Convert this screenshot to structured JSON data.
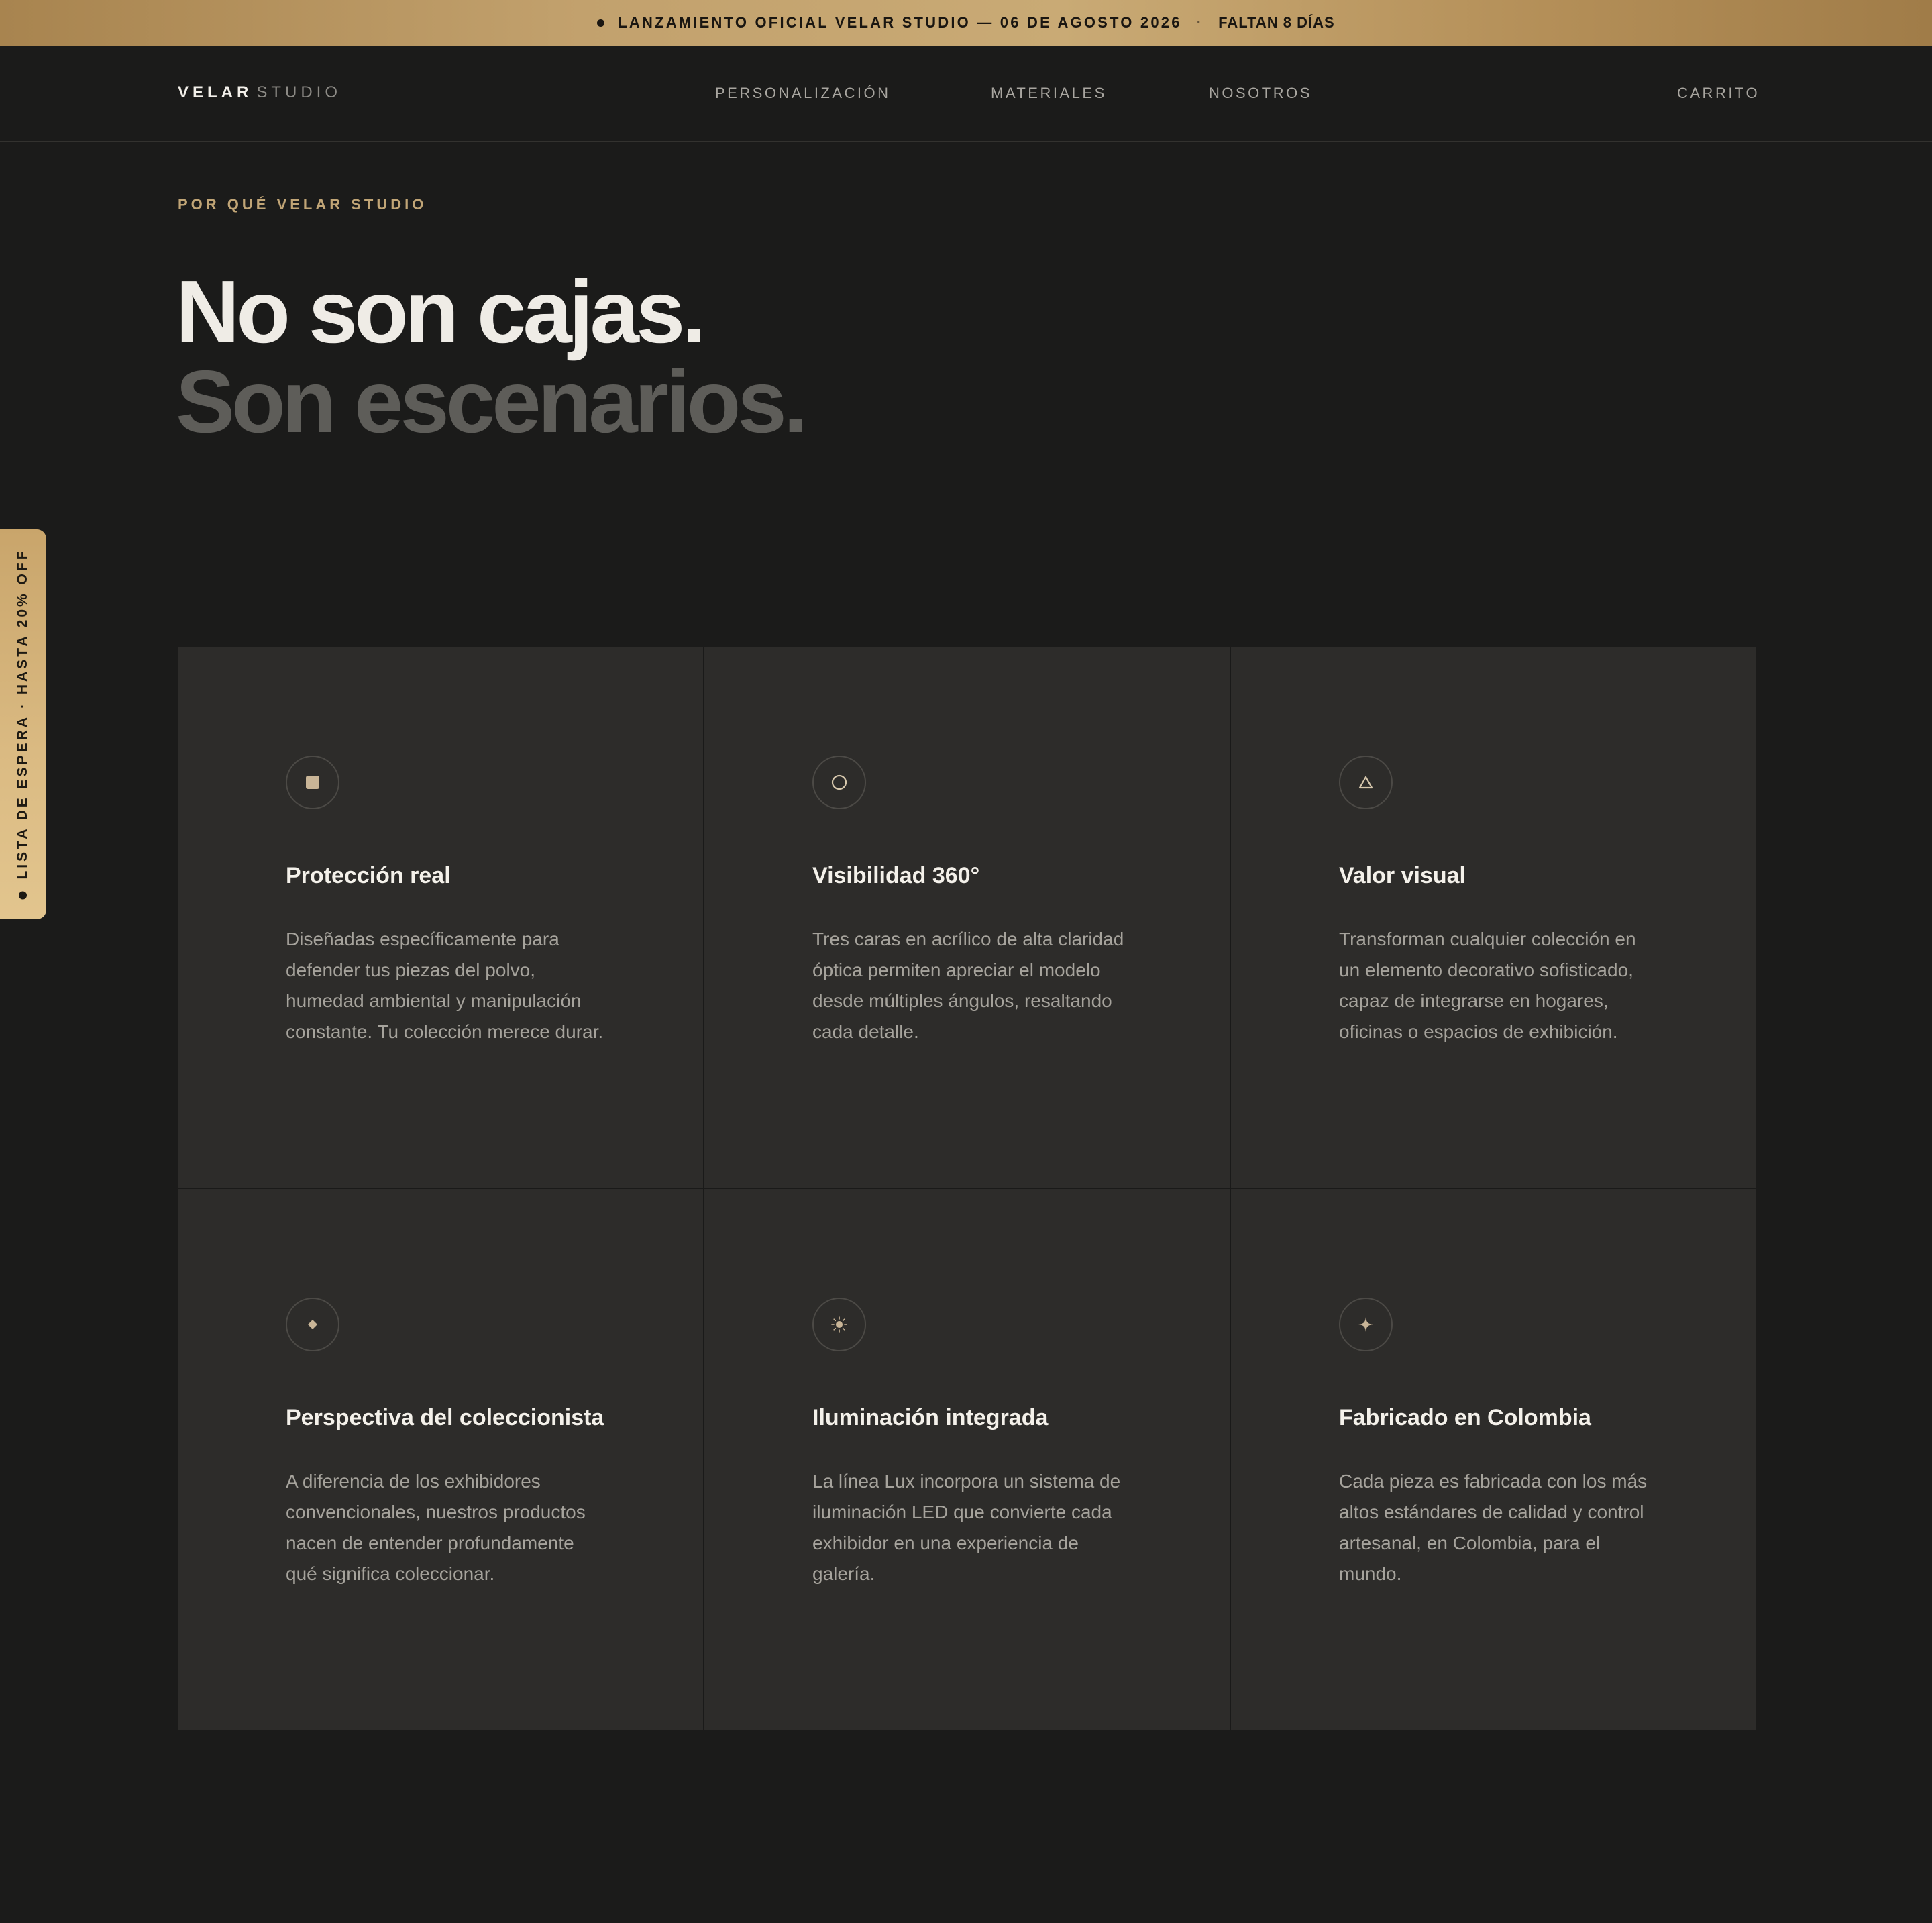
{
  "banner": {
    "text": "LANZAMIENTO OFICIAL VELAR STUDIO — 06 DE AGOSTO 2026",
    "separator": "·",
    "countdown": "FALTAN 8 DÍAS"
  },
  "nav": {
    "logo_bold": "VELAR",
    "logo_light": "STUDIO",
    "links": [
      "PERSONALIZACIÓN",
      "MATERIALES",
      "NOSOTROS"
    ],
    "cart": "CARRITO"
  },
  "hero": {
    "eyebrow": "POR QUÉ VELAR STUDIO",
    "line1": "No son cajas.",
    "line2": "Son escenarios."
  },
  "side_tab": {
    "label": "LISTA DE ESPERA · HASTA 20% OFF"
  },
  "colors": {
    "accent": "#c1a576",
    "background": "#1b1b1a",
    "card": "#2d2c2a"
  },
  "features": [
    {
      "icon": "square-icon",
      "title": "Protección real",
      "description": "Diseñadas específicamente para defender tus piezas del polvo, humedad ambiental y manipulación constante. Tu colección merece durar."
    },
    {
      "icon": "circle-icon",
      "title": "Visibilidad 360°",
      "description": "Tres caras en acrílico de alta claridad óptica permiten apreciar el modelo desde múltiples ángulos, resaltando cada detalle."
    },
    {
      "icon": "triangle-icon",
      "title": "Valor visual",
      "description": "Transforman cualquier colección en un elemento decorativo sofisticado, capaz de integrarse en hogares, oficinas o espacios de exhibición."
    },
    {
      "icon": "diamond-icon",
      "title": "Perspectiva del coleccionista",
      "description": "A diferencia de los exhibidores convencionales, nuestros productos nacen de entender profundamente qué significa coleccionar."
    },
    {
      "icon": "sun-icon",
      "title": "Iluminación integrada",
      "description": "La línea Lux incorpora un sistema de iluminación LED que convierte cada exhibidor en una experiencia de galería."
    },
    {
      "icon": "sparkle-icon",
      "title": "Fabricado en Colombia",
      "description": "Cada pieza es fabricada con los más altos estándares de calidad y control artesanal, en Colombia, para el mundo."
    }
  ]
}
